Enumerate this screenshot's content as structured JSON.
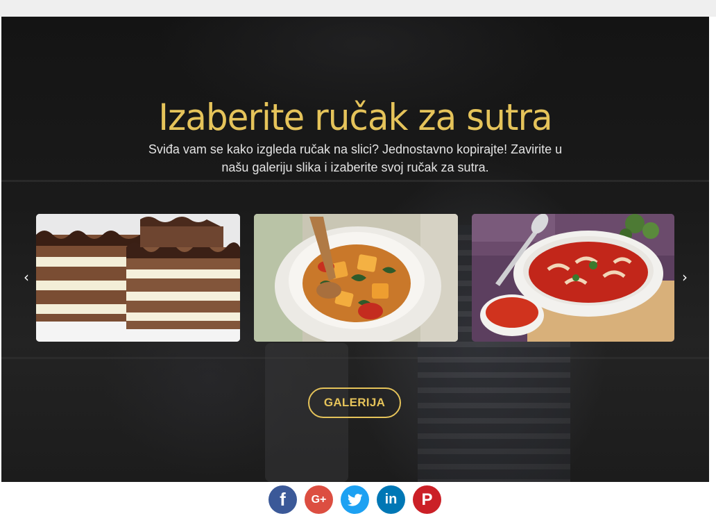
{
  "hero": {
    "title": "Izaberite ručak za sutra",
    "text": "Sviđa vam se kako izgleda ručak na slici? Jednostavno kopirajte! Zavirite u našu galeriju slika i izaberite svoj ručak za sutra.",
    "accent_color": "#e5c35a"
  },
  "carousel": {
    "prev_icon": "‹",
    "next_icon": "›",
    "slides": [
      {
        "icon": "layered-chocolate-cake-image"
      },
      {
        "icon": "vegetable-curry-bowl-image"
      },
      {
        "icon": "tomato-stew-dish-image"
      }
    ]
  },
  "gallery_button": {
    "label": "GALERIJA"
  },
  "social": {
    "facebook": {
      "glyph": "f",
      "color": "#3b5998"
    },
    "google_plus": {
      "glyph": "G+",
      "color": "#dc4e41"
    },
    "twitter": {
      "color": "#1da1f2"
    },
    "linkedin": {
      "glyph": "in",
      "color": "#0077b5"
    },
    "pinterest": {
      "glyph": "P",
      "color": "#cb2027"
    }
  }
}
